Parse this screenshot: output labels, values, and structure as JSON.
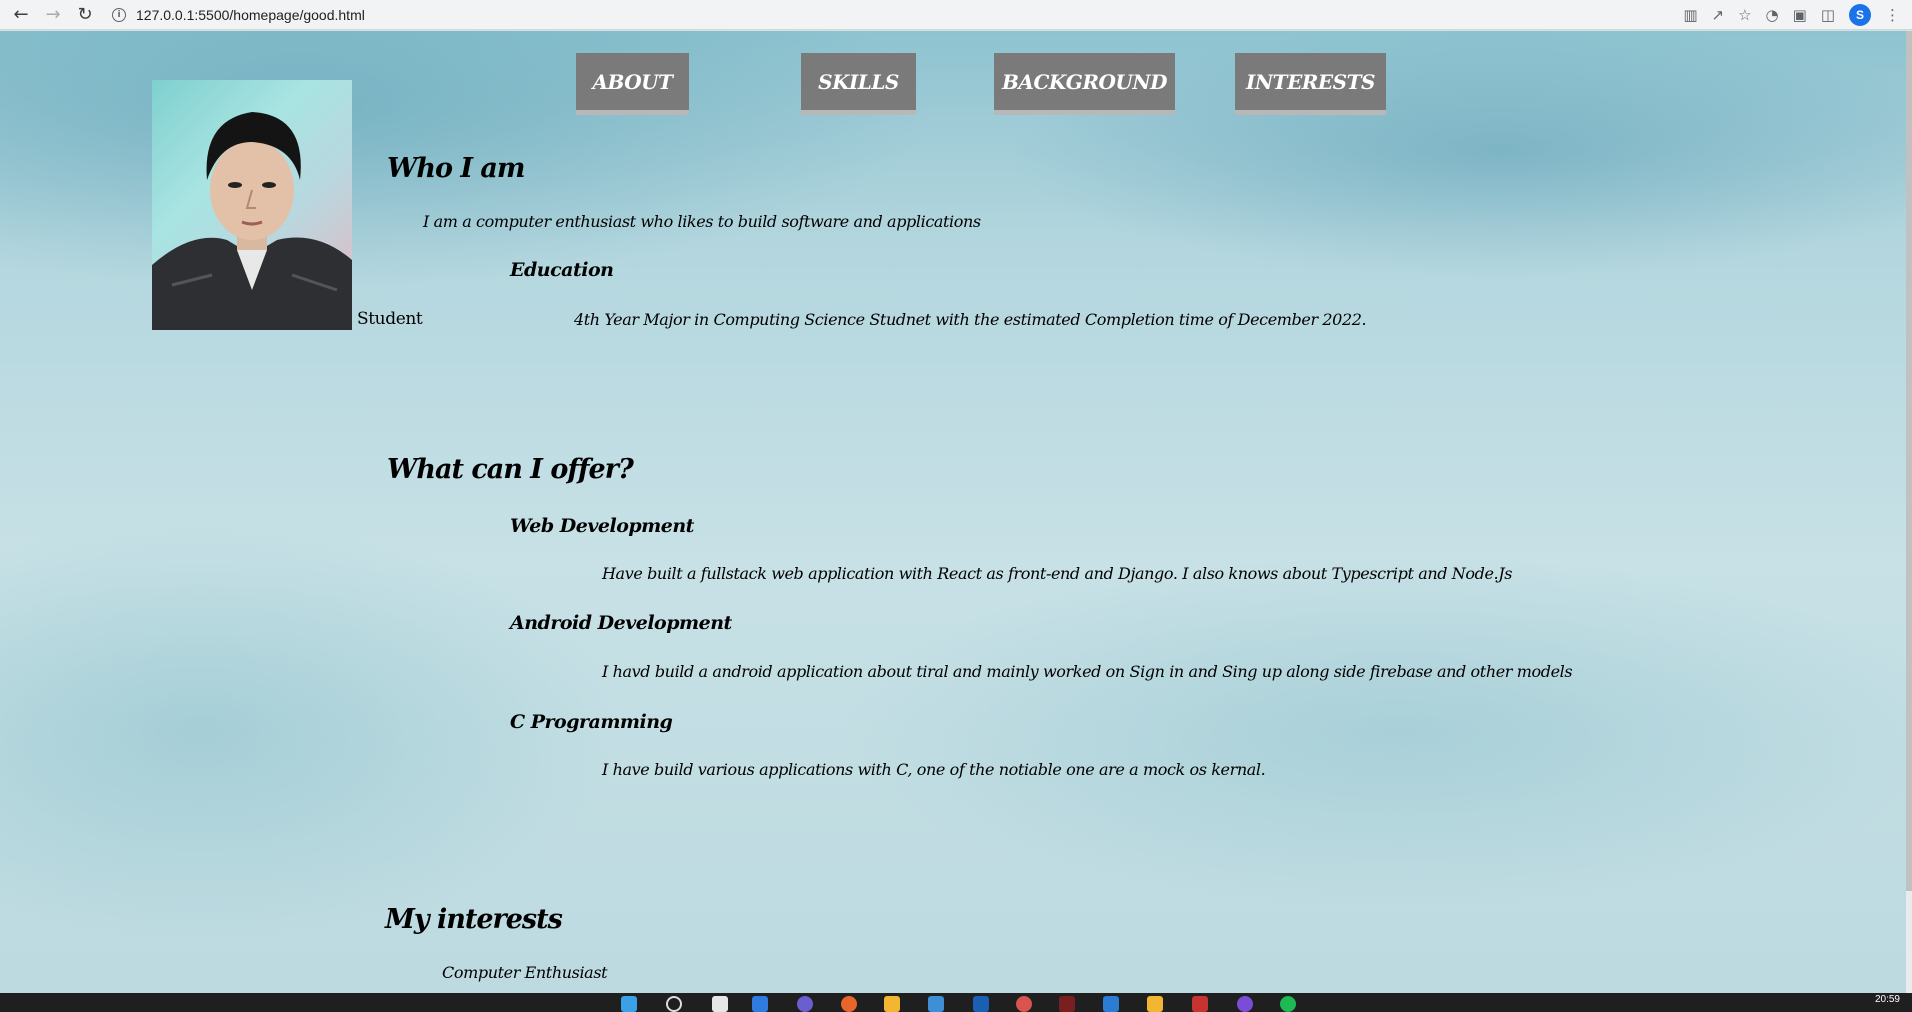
{
  "browser": {
    "back_icon": "arrow-left-icon",
    "forward_icon": "arrow-right-icon",
    "reload_icon": "reload-icon",
    "url": "127.0.0.1:5500/homepage/good.html",
    "profile_initial": "S"
  },
  "nav": {
    "tabs": [
      {
        "label": "ABOUT"
      },
      {
        "label": "SKILLS"
      },
      {
        "label": "BACKGROUND"
      },
      {
        "label": "INTERESTS"
      }
    ]
  },
  "about": {
    "photo_caption": "Student",
    "heading": "Who I am",
    "intro": "I am a computer enthusiast who likes to build software and applications",
    "education_heading": "Education",
    "education_text": "4th Year Major in Computing Science Studnet with the estimated Completion time of December 2022."
  },
  "skills": {
    "heading": "What can I offer?",
    "items": [
      {
        "title": "Web Development",
        "text": "Have built a fullstack web application with React as front-end and Django. I also knows about Typescript and Node.Js"
      },
      {
        "title": "Android Development",
        "text": "I havd build a android application about tiral and mainly worked on Sign in and Sing up along side firebase and other models"
      },
      {
        "title": "C Programming",
        "text": "I have build various applications with C, one of the notiable one are a mock os kernal."
      }
    ]
  },
  "interests": {
    "heading": "My interests",
    "first_item": "Computer Enthusiast"
  },
  "taskbar": {
    "time": "20:59"
  },
  "colors": {
    "tab_bg": "#7a7a7a",
    "tab_text": "#ffffff",
    "page_bg": "#bcdae0"
  }
}
